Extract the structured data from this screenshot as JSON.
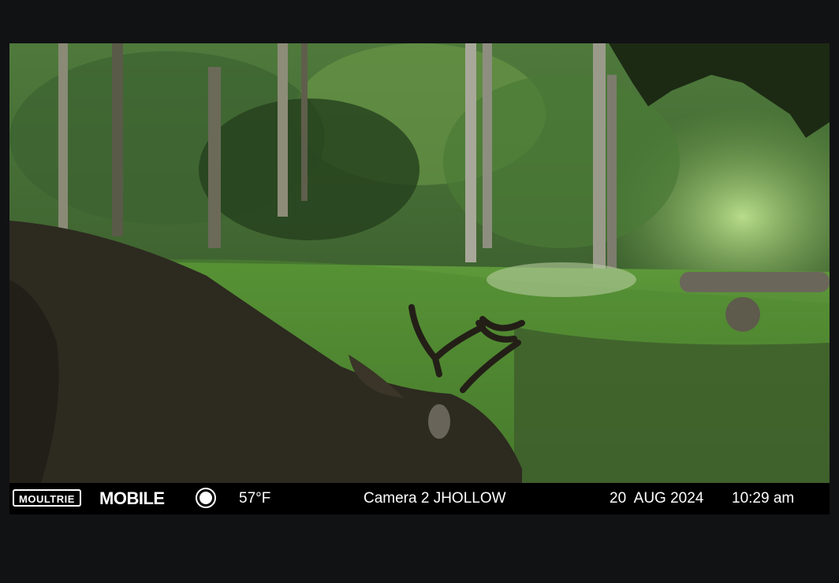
{
  "info_bar": {
    "brand_logo": "MOULTRIE",
    "brand_mobile": "MOBILE",
    "moon_icon": "full-moon-icon",
    "temperature": "57°F",
    "camera_name": "Camera 2 JHOLLOW",
    "date": "20  AUG 2024",
    "time": "10:29 am"
  }
}
